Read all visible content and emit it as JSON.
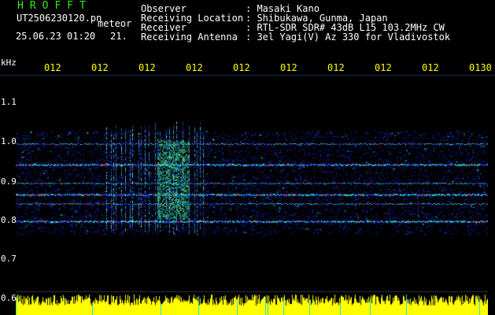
{
  "header": {
    "brand": "HROFFT",
    "filename": "UT2506230120.pn",
    "tag": "meteor",
    "datetime": "25.06.23 01:20",
    "frame": "21."
  },
  "metadata": [
    {
      "key": "Observer",
      "value": ": Masaki Kano"
    },
    {
      "key": "Receiving Location",
      "value": ": Shibukawa, Gunma, Japan"
    },
    {
      "key": "Receiver",
      "value": ": RTL-SDR SDR# 43dB L15 103.2MHz CW"
    },
    {
      "key": "Receiving Antenna",
      "value": ": 3el Yagi(V) Az 330 for Vladivostok"
    }
  ],
  "axis": {
    "unit": "kHz",
    "y_ticks": [
      "1.1",
      "1.0",
      "0.9",
      "0.8",
      "0.7",
      "0.6"
    ],
    "x_ticks": [
      "012",
      "012",
      "012",
      "012",
      "012",
      "012",
      "012",
      "012",
      "012",
      "0130"
    ]
  },
  "colors": {
    "background": "#000000",
    "brand": "#39e81e",
    "text": "#ffffff",
    "time_ticks": "#ffff00",
    "noise_floor": "#ffff00",
    "signal_low": "#1a2fc8",
    "signal_mid": "#22d8d8",
    "signal_high": "#ff3030"
  }
}
